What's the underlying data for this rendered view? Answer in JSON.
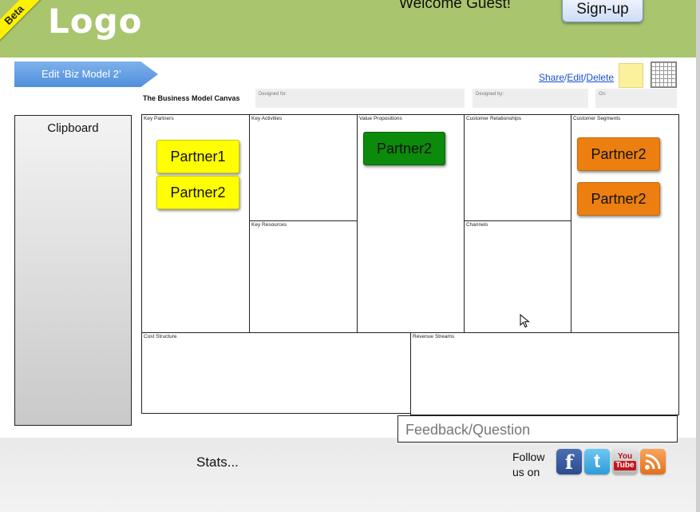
{
  "header": {
    "beta_ribbon": "Beta",
    "logo": "Logo",
    "welcome": "Welcome Guest!",
    "signup_label": "Sign-up",
    "background_color": "#a9c56e"
  },
  "toolbar": {
    "edit_label": "Edit ‘Biz Model 2’",
    "share_label": "Share",
    "edit_link_label": "Edit",
    "delete_label": "Delete",
    "separator": "/",
    "note_icon": "sticky-note-icon",
    "grid_icon": "grid-icon"
  },
  "canvas_header": {
    "title": "The Business Model Canvas",
    "designed_for_label": "Designed for:",
    "designed_by_label": "Designed by:",
    "on_label": "On:"
  },
  "clipboard": {
    "title": "Clipboard"
  },
  "cells": {
    "key_partners": "Key Partners",
    "key_activities": "Key Activities",
    "key_resources": "Key Resources",
    "value_propositions": "Value Propositions",
    "customer_relationships": "Customer Relationships",
    "channels": "Channels",
    "customer_segments": "Customer Segments",
    "cost_structure": "Cost Structure",
    "revenue_streams": "Revenue Streams"
  },
  "notes": {
    "key_partners": [
      "Partner1",
      "Partner2"
    ],
    "value_propositions": [
      "Partner2"
    ],
    "customer_segments": [
      "Partner2",
      "Partner2"
    ],
    "colors": {
      "yellow": "#ffff00",
      "green": "#0b8a0b",
      "orange": "#ec7f0f"
    }
  },
  "footer": {
    "stats": "Stats...",
    "feedback_placeholder": "Feedback/Question",
    "follow_line1": "Follow",
    "follow_line2": "us on",
    "social_icons": [
      "facebook-icon",
      "twitter-icon",
      "youtube-icon",
      "rss-icon"
    ],
    "youtube_text_1": "You",
    "youtube_text_2": "Tube"
  }
}
